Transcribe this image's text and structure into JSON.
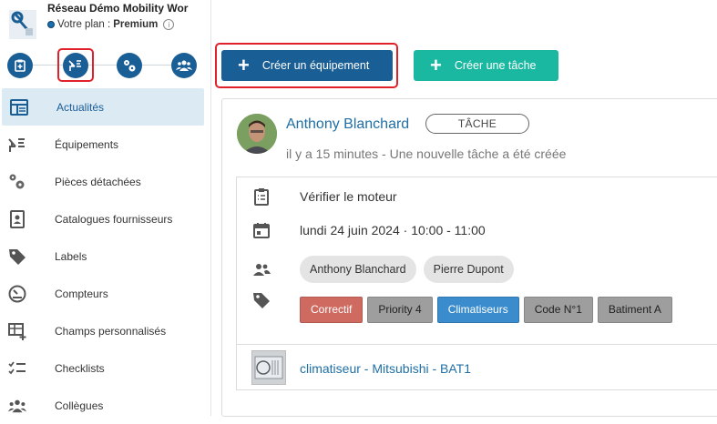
{
  "org": {
    "name": "Réseau Démo Mobility Wor",
    "plan_prefix": "Votre plan : ",
    "plan_name": "Premium",
    "info_glyph": "i"
  },
  "quick_actions": [
    "clipboard-plus-icon",
    "equipment-icon",
    "parts-icon",
    "team-icon"
  ],
  "nav": [
    {
      "label": "Actualités",
      "icon": "feed-icon",
      "active": true
    },
    {
      "label": "Équipements",
      "icon": "equipment-icon"
    },
    {
      "label": "Pièces détachées",
      "icon": "parts-icon"
    },
    {
      "label": "Catalogues fournisseurs",
      "icon": "catalog-icon"
    },
    {
      "label": "Labels",
      "icon": "tag-icon"
    },
    {
      "label": "Compteurs",
      "icon": "gauge-icon"
    },
    {
      "label": "Champs personnalisés",
      "icon": "custom-fields-icon"
    },
    {
      "label": "Checklists",
      "icon": "checklist-icon"
    },
    {
      "label": "Collègues",
      "icon": "people-icon"
    }
  ],
  "toolbar": {
    "create_equipment": "Créer un équipement",
    "create_task": "Créer une tâche",
    "plus": "+"
  },
  "feed_item": {
    "author": "Anthony Blanchard",
    "type_badge": "TÂCHE",
    "timeline": "il y a 15 minutes - Une nouvelle tâche a été créée",
    "title": "Vérifier le moteur",
    "schedule": "lundi 24 juin 2024 · 10:00 - 11:00",
    "assignees": [
      "Anthony Blanchard",
      "Pierre Dupont"
    ],
    "labels": [
      {
        "text": "Correctif",
        "color": "#cf6a60",
        "text_color": "#ffffff"
      },
      {
        "text": "Priority 4",
        "color": "#9e9e9e",
        "text_color": "#222222"
      },
      {
        "text": "Climatiseurs",
        "color": "#3a8ccc",
        "text_color": "#ffffff"
      },
      {
        "text": "Code N°1",
        "color": "#9e9e9e",
        "text_color": "#222222"
      },
      {
        "text": "Batiment A",
        "color": "#9e9e9e",
        "text_color": "#222222"
      }
    ],
    "equipment": "climatiseur - Mitsubishi - BAT1"
  },
  "colors": {
    "primary": "#1a5e96",
    "teal": "#1ab8a0",
    "link": "#1f6fa5",
    "highlight": "#e0202a"
  }
}
